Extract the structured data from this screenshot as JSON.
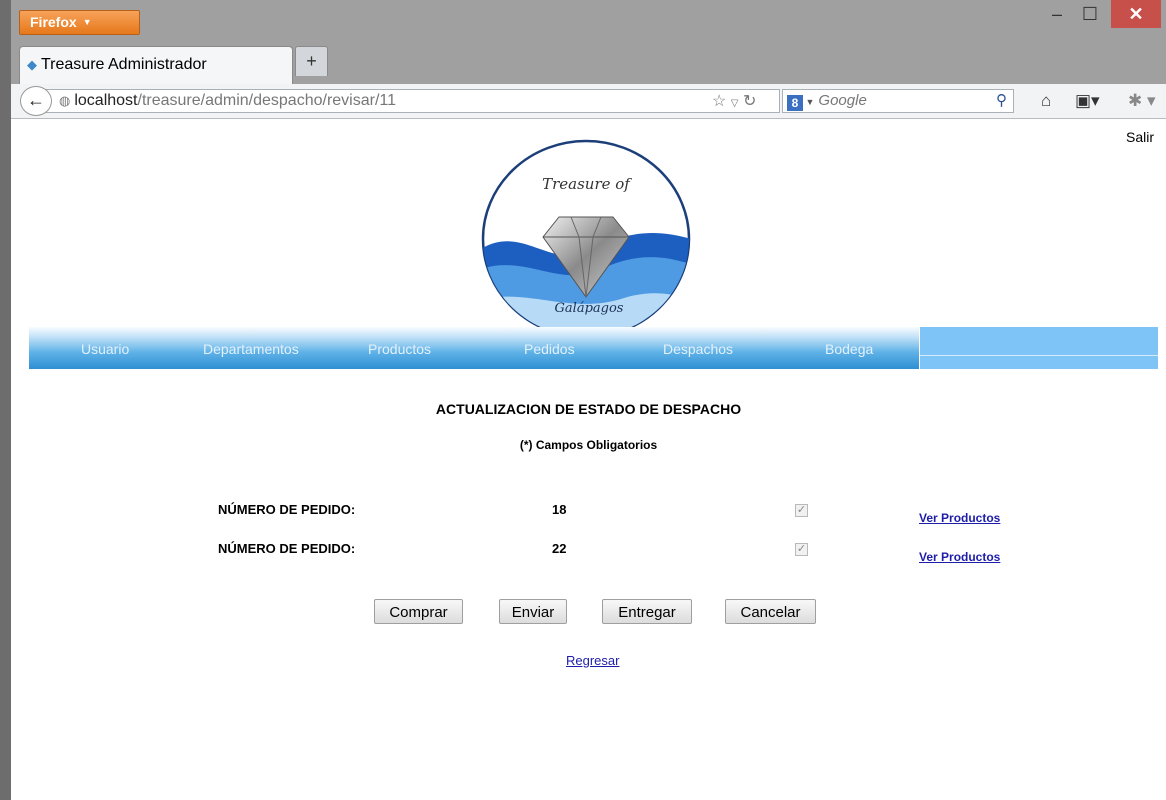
{
  "browser": {
    "app_button_label": "Firefox",
    "tab_title": "Treasure Administrador",
    "new_tab_label": "+",
    "url_host": "localhost",
    "url_path": "/treasure/admin/despacho/revisar/11",
    "search_placeholder": "Google",
    "search_engine_badge": "8"
  },
  "page": {
    "salir_label": "Salir",
    "logo": {
      "top_text": "Treasure of",
      "bottom_text": "Galápagos"
    },
    "menu": [
      "Usuario",
      "Departamentos",
      "Productos",
      "Pedidos",
      "Despachos",
      "Bodega"
    ],
    "heading": "ACTUALIZACION DE ESTADO DE DESPACHO",
    "subheading": "(*) Campos Obligatorios",
    "orders": [
      {
        "label": "NÚMERO DE PEDIDO:",
        "number": "18",
        "checked": true,
        "link": "Ver Productos"
      },
      {
        "label": "NÚMERO DE PEDIDO:",
        "number": "22",
        "checked": true,
        "link": "Ver Productos"
      }
    ],
    "buttons": {
      "comprar": "Comprar",
      "enviar": "Enviar",
      "entregar": "Entregar",
      "cancelar": "Cancelar"
    },
    "back_link": "Regresar"
  },
  "colors": {
    "menu_blue": "#2f8fd3",
    "link_blue": "#1d1daa",
    "firefox_orange": "#e6781b",
    "close_red": "#c7504b"
  }
}
